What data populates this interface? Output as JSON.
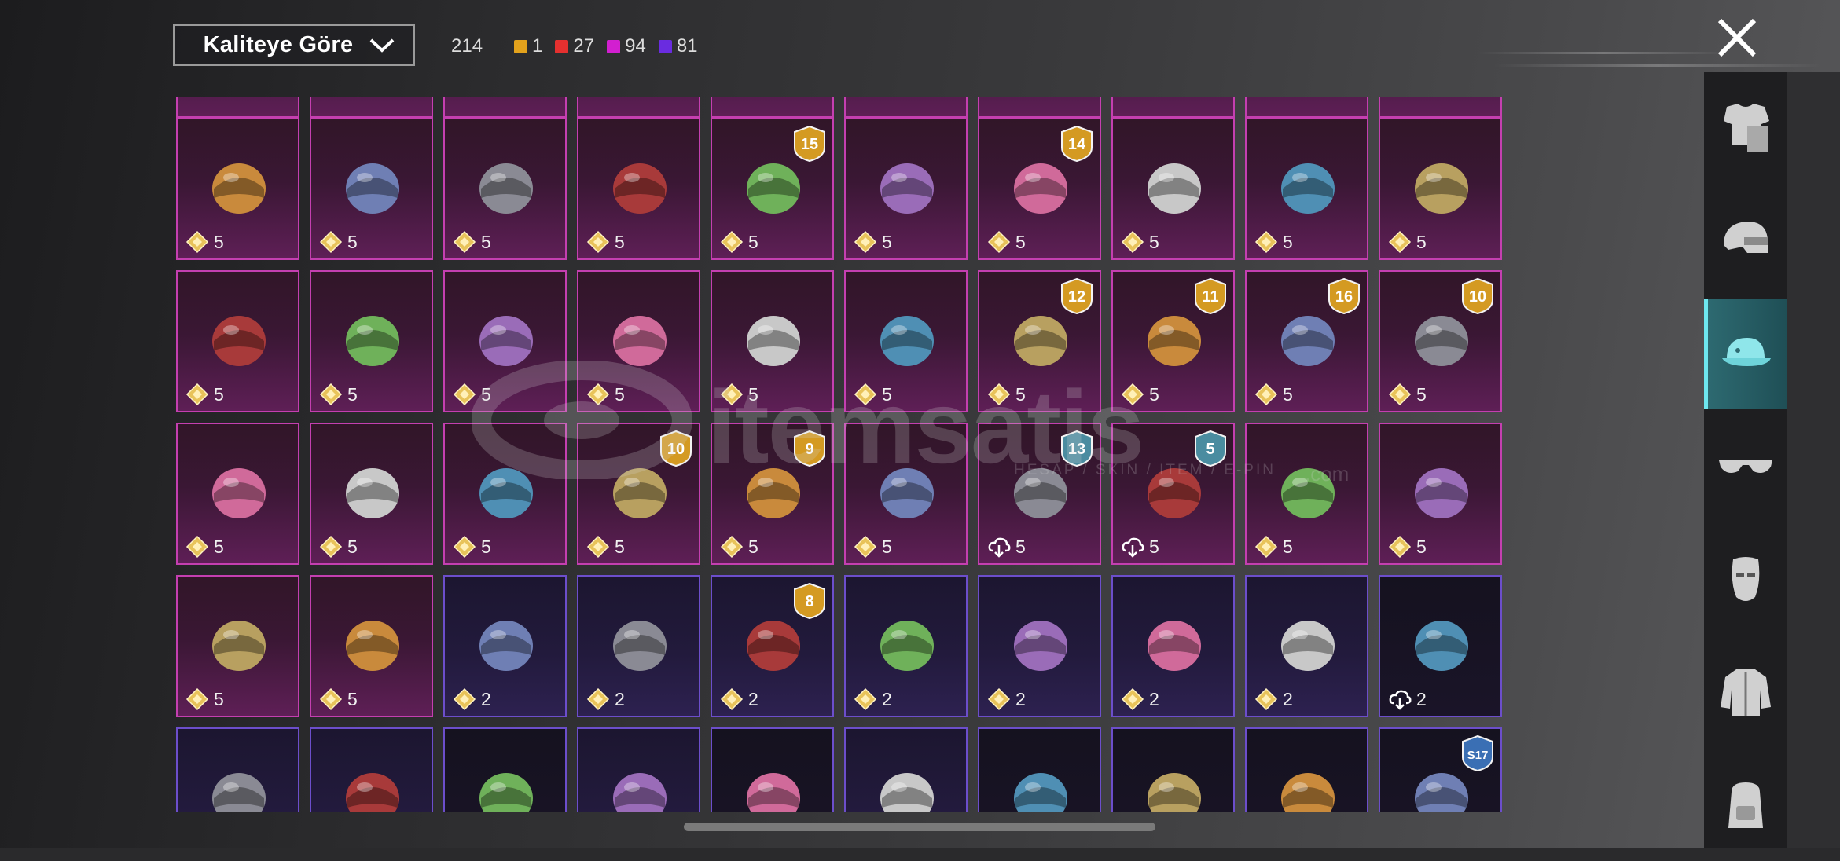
{
  "sort_dropdown": {
    "label": "Kaliteye Göre"
  },
  "counts": {
    "total": "214",
    "by_tier": [
      {
        "color": "#e3a21c",
        "value": "1"
      },
      {
        "color": "#e5302f",
        "value": "27"
      },
      {
        "color": "#d21fd0",
        "value": "94"
      },
      {
        "color": "#6a2ce0",
        "value": "81"
      }
    ]
  },
  "watermark": {
    "text": "itemsatis",
    "subtext": "HESAP / SKIN / ITEM / E-PIN",
    "suffix": ".com"
  },
  "sidebar": {
    "categories": [
      {
        "icon": "outfit-icon",
        "active": false
      },
      {
        "icon": "helmet-icon",
        "active": false
      },
      {
        "icon": "cap-icon",
        "active": true
      },
      {
        "icon": "glasses-icon",
        "active": false
      },
      {
        "icon": "face-mask-icon",
        "active": false
      },
      {
        "icon": "jacket-icon",
        "active": false
      },
      {
        "icon": "backpack-icon",
        "active": false
      }
    ]
  },
  "rows": [
    [
      {
        "icon": "animal-costume-head-icon",
        "value": "5",
        "rarity": "legendary",
        "badge": ""
      },
      {
        "icon": "pigtail-wig-icon",
        "value": "5",
        "rarity": "legendary",
        "badge": ""
      },
      {
        "icon": "bow-helmet-icon",
        "value": "5",
        "rarity": "legendary",
        "badge": ""
      },
      {
        "icon": "feather-hat-icon",
        "value": "5",
        "rarity": "legendary",
        "badge": ""
      },
      {
        "icon": "armored-helmet-icon",
        "value": "5",
        "rarity": "legendary",
        "badge": "15"
      },
      {
        "icon": "wolf-mask-icon",
        "value": "5",
        "rarity": "legendary",
        "badge": ""
      },
      {
        "icon": "spiked-cap-icon",
        "value": "5",
        "rarity": "legendary",
        "badge": "14"
      },
      {
        "icon": "deer-head-icon",
        "value": "5",
        "rarity": "legendary",
        "badge": ""
      },
      {
        "icon": "tribal-mask-icon",
        "value": "5",
        "rarity": "legendary",
        "badge": ""
      },
      {
        "icon": "jester-hat-icon",
        "value": "5",
        "rarity": "legendary",
        "badge": ""
      }
    ],
    [
      {
        "icon": "horned-demon-mask-icon",
        "value": "5",
        "rarity": "legendary",
        "badge": ""
      },
      {
        "icon": "crown-mask-icon",
        "value": "5",
        "rarity": "legendary",
        "badge": ""
      },
      {
        "icon": "red-crowned-skull-icon",
        "value": "5",
        "rarity": "legendary",
        "badge": ""
      },
      {
        "icon": "dreadlock-skull-icon",
        "value": "5",
        "rarity": "legendary",
        "badge": ""
      },
      {
        "icon": "frog-ranger-hat-icon",
        "value": "5",
        "rarity": "legendary",
        "badge": ""
      },
      {
        "icon": "frog-police-cap-icon",
        "value": "5",
        "rarity": "legendary",
        "badge": ""
      },
      {
        "icon": "gas-mask-icon",
        "value": "5",
        "rarity": "legendary",
        "badge": "12"
      },
      {
        "icon": "pink-cap-icon",
        "value": "5",
        "rarity": "legendary",
        "badge": "11"
      },
      {
        "icon": "tactical-helmet-icon",
        "value": "5",
        "rarity": "legendary",
        "badge": "16"
      },
      {
        "icon": "aviator-hat-icon",
        "value": "5",
        "rarity": "legendary",
        "badge": "10"
      }
    ],
    [
      {
        "icon": "frankenstein-mask-icon",
        "value": "5",
        "rarity": "legendary",
        "badge": ""
      },
      {
        "icon": "gold-visor-helmet-icon",
        "value": "5",
        "rarity": "legendary",
        "badge": ""
      },
      {
        "icon": "white-hair-mask-icon",
        "value": "5",
        "rarity": "legendary",
        "badge": ""
      },
      {
        "icon": "red-beret-icon",
        "value": "5",
        "rarity": "legendary",
        "badge": "10"
      },
      {
        "icon": "long-white-hair-icon",
        "value": "5",
        "rarity": "legendary",
        "badge": "9"
      },
      {
        "icon": "crab-hat-icon",
        "value": "5",
        "rarity": "legendary",
        "badge": ""
      },
      {
        "icon": "blue-hood-icon",
        "value": "5",
        "rarity": "legendary",
        "badge": "13",
        "download": true
      },
      {
        "icon": "white-wide-hat-icon",
        "value": "5",
        "rarity": "legendary",
        "badge": "5",
        "download": true
      },
      {
        "icon": "horn-headband-icon",
        "value": "5",
        "rarity": "legendary",
        "badge": ""
      },
      {
        "icon": "top-hat-icon",
        "value": "5",
        "rarity": "legendary",
        "badge": ""
      }
    ],
    [
      {
        "icon": "small-bow-icon",
        "value": "5",
        "rarity": "legendary",
        "badge": ""
      },
      {
        "icon": "silver-tiara-icon",
        "value": "5",
        "rarity": "legendary",
        "badge": ""
      },
      {
        "icon": "black-long-hair-icon",
        "value": "2",
        "rarity": "epic",
        "badge": ""
      },
      {
        "icon": "silver-long-hair-icon",
        "value": "2",
        "rarity": "epic",
        "badge": ""
      },
      {
        "icon": "green-skull-hair-icon",
        "value": "2",
        "rarity": "epic",
        "badge": "8"
      },
      {
        "icon": "baseball-cap-icon",
        "value": "2",
        "rarity": "epic",
        "badge": ""
      },
      {
        "icon": "brown-messy-hair-icon",
        "value": "2",
        "rarity": "epic",
        "badge": ""
      },
      {
        "icon": "green-visor-helmet-icon",
        "value": "2",
        "rarity": "epic",
        "badge": ""
      },
      {
        "icon": "motorcycle-helmet-icon",
        "value": "2",
        "rarity": "epic",
        "badge": ""
      },
      {
        "icon": "goggles-red-hair-icon",
        "value": "2",
        "rarity": "dark",
        "badge": "",
        "download": true
      }
    ],
    [
      {
        "icon": "colorful-cap-icon",
        "value": "",
        "rarity": "epic",
        "badge": ""
      },
      {
        "icon": "purple-helmet-icon",
        "value": "",
        "rarity": "epic",
        "badge": ""
      },
      {
        "icon": "red-white-cap-icon",
        "value": "",
        "rarity": "dark",
        "badge": ""
      },
      {
        "icon": "blonde-hair-icon",
        "value": "",
        "rarity": "epic",
        "badge": ""
      },
      {
        "icon": "sun-hat-icon",
        "value": "",
        "rarity": "dark",
        "badge": ""
      },
      {
        "icon": "cat-ears-icon",
        "value": "",
        "rarity": "epic",
        "badge": ""
      },
      {
        "icon": "navy-beanie-icon",
        "value": "",
        "rarity": "dark",
        "badge": ""
      },
      {
        "icon": "black-studded-cap-icon",
        "value": "",
        "rarity": "dark",
        "badge": ""
      },
      {
        "icon": "bucket-hat-icon",
        "value": "",
        "rarity": "dark",
        "badge": ""
      },
      {
        "icon": "horned-knight-helmet-icon",
        "value": "",
        "rarity": "dark",
        "badge": "S17"
      }
    ]
  ]
}
